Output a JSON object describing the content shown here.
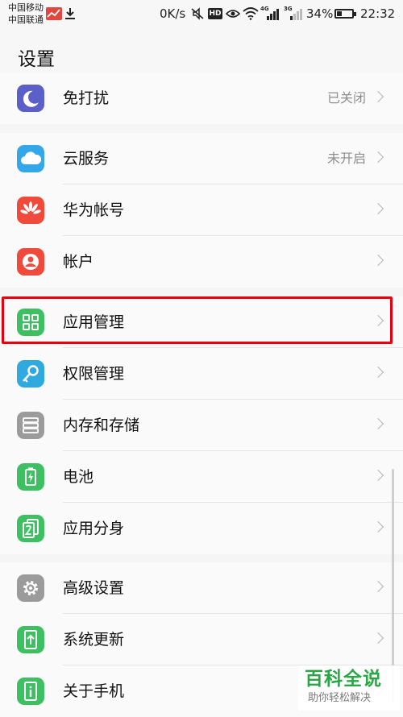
{
  "status_bar": {
    "carrier1": "中国移动",
    "carrier2": "中国联通",
    "speed": "0K/s",
    "hd": "HD",
    "net1": "4G",
    "net2": "3G",
    "battery_percent": "34%",
    "battery_level": 0.34,
    "time": "22:32"
  },
  "header": {
    "title": "设置"
  },
  "groups": [
    {
      "items": [
        {
          "label": "免打扰",
          "value": "已关闭",
          "icon": "moon-icon",
          "color": "#5b5fc7"
        }
      ]
    },
    {
      "items": [
        {
          "label": "云服务",
          "value": "未开启",
          "icon": "cloud-icon",
          "color": "#33a7e8"
        },
        {
          "label": "华为帐号",
          "value": "",
          "icon": "huawei-icon",
          "color": "#f04a3c"
        },
        {
          "label": "帐户",
          "value": "",
          "icon": "account-icon",
          "color": "#f04a3c"
        }
      ]
    },
    {
      "items": [
        {
          "label": "应用管理",
          "value": "",
          "icon": "apps-icon",
          "color": "#3ec062"
        },
        {
          "label": "权限管理",
          "value": "",
          "icon": "key-icon",
          "color": "#30a9df"
        },
        {
          "label": "内存和存储",
          "value": "",
          "icon": "storage-icon",
          "color": "#9b9b9b"
        },
        {
          "label": "电池",
          "value": "",
          "icon": "battery-icon",
          "color": "#3ec062"
        },
        {
          "label": "应用分身",
          "value": "",
          "icon": "app-twin-icon",
          "color": "#3ec062"
        }
      ]
    },
    {
      "items": [
        {
          "label": "高级设置",
          "value": "",
          "icon": "gear-icon",
          "color": "#9b9b9b"
        },
        {
          "label": "系统更新",
          "value": "",
          "icon": "update-icon",
          "color": "#3ec062"
        },
        {
          "label": "关于手机",
          "value": "",
          "icon": "info-icon",
          "color": "#3ec062"
        }
      ]
    }
  ],
  "watermark": {
    "title": "百科全说",
    "subtitle": "助你轻松解决"
  }
}
